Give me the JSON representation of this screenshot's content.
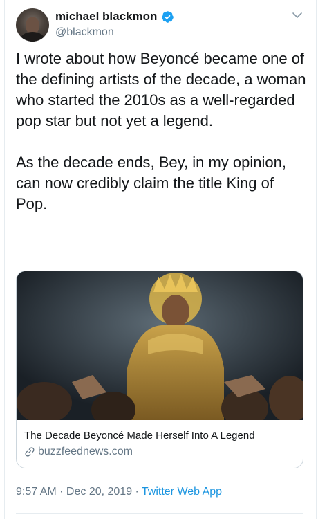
{
  "tweet": {
    "author": {
      "display_name": "michael blackmon",
      "handle": "@blackmon",
      "verified": true
    },
    "text": "I wrote about how Beyoncé became one of the defining artists of the decade, a woman who started the 2010s as a well-regarded pop star but not yet a legend.\n\nAs the decade ends, Bey, in my opinion, can now credibly claim the title King of Pop.",
    "link_card": {
      "title": "The Decade Beyoncé Made Herself Into A Legend",
      "domain": "buzzfeednews.com"
    },
    "timestamp": "9:57 AM · Dec 20, 2019 ·",
    "source": "Twitter Web App"
  },
  "colors": {
    "verified_blue": "#1da1f2",
    "link_blue": "#1b95e0",
    "secondary_text": "#657786",
    "border": "#ccd6dd"
  },
  "icons": {
    "verified": "verified-badge-icon",
    "caret": "chevron-down-icon",
    "link": "link-icon"
  }
}
